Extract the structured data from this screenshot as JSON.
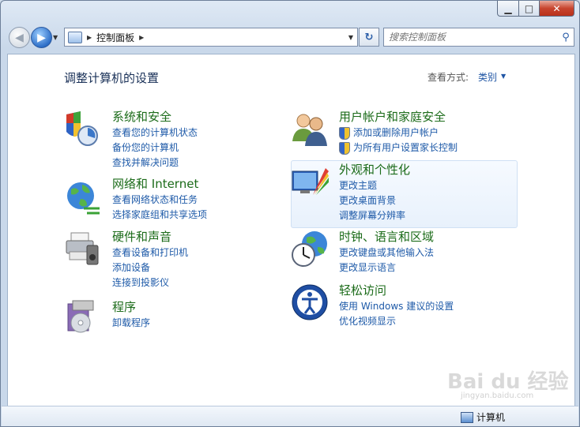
{
  "nav": {
    "breadcrumb": "控制面板",
    "search_placeholder": "搜索控制面板"
  },
  "main": {
    "page_title": "调整计算机的设置",
    "view_by_label": "查看方式:",
    "view_by_value": "类别"
  },
  "categories": [
    {
      "title": "系统和安全",
      "links": [
        "查看您的计算机状态",
        "备份您的计算机",
        "查找并解决问题"
      ]
    },
    {
      "title": "网络和 Internet",
      "links": [
        "查看网络状态和任务",
        "选择家庭组和共享选项"
      ]
    },
    {
      "title": "硬件和声音",
      "links": [
        "查看设备和打印机",
        "添加设备",
        "连接到投影仪"
      ]
    },
    {
      "title": "程序",
      "links": [
        "卸载程序"
      ]
    },
    {
      "title": "用户帐户和家庭安全",
      "links": [
        "添加或删除用户帐户",
        "为所有用户设置家长控制"
      ]
    },
    {
      "title": "外观和个性化",
      "links": [
        "更改主题",
        "更改桌面背景",
        "调整屏幕分辨率"
      ]
    },
    {
      "title": "时钟、语言和区域",
      "links": [
        "更改键盘或其他输入法",
        "更改显示语言"
      ]
    },
    {
      "title": "轻松访问",
      "links": [
        "使用 Windows 建议的设置",
        "优化视频显示"
      ]
    }
  ],
  "status_bar": {
    "computer_label": "计算机"
  },
  "watermark": {
    "text": "Bai du 经验",
    "url": "jingyan.baidu.com"
  },
  "colors": {
    "category_title": "#1b6b19",
    "link": "#1e5aa8",
    "page_title": "#1a3158"
  },
  "icons": [
    "back-arrow-icon",
    "forward-arrow-icon",
    "control-panel-icon",
    "refresh-icon",
    "search-icon",
    "shield-icon",
    "computer-icon"
  ]
}
